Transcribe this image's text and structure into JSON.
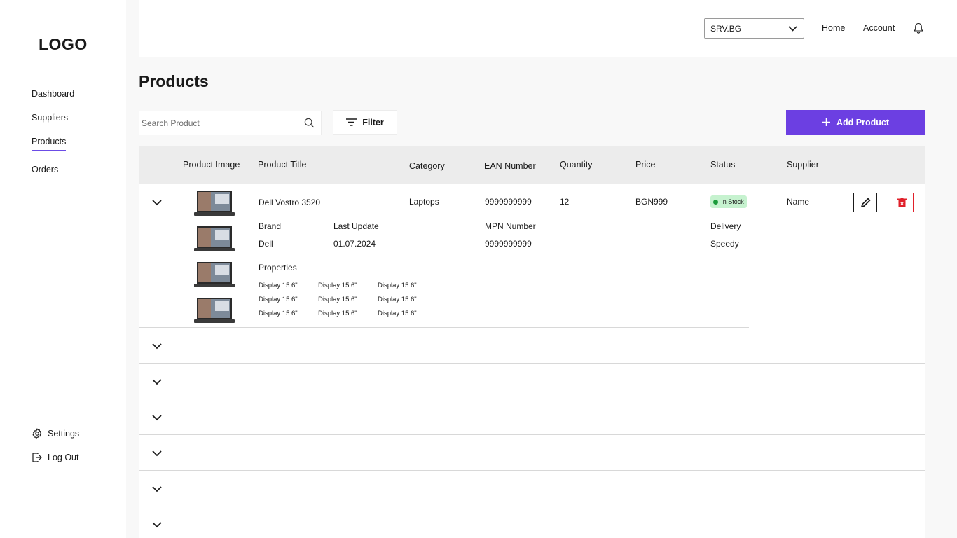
{
  "sidebar": {
    "logo": "LOGO",
    "items": [
      {
        "label": "Dashboard"
      },
      {
        "label": "Suppliers"
      },
      {
        "label": "Products"
      },
      {
        "label": "Orders"
      }
    ],
    "settings_label": "Settings",
    "logout_label": "Log Out",
    "active_item": "Products"
  },
  "header": {
    "store_select": "SRV.BG",
    "home_label": "Home",
    "account_label": "Account"
  },
  "main": {
    "title": "Products",
    "search_placeholder": "Search Product",
    "filter_label": "Filter",
    "add_label": "Add Product",
    "accent_color": "#6c3fe2"
  },
  "table": {
    "columns": [
      "Product Image",
      "Product Title",
      "Category",
      "EAN Number",
      "Quantity",
      "Price",
      "Status",
      "Supplier"
    ],
    "expanded_row": {
      "title": "Dell Vostro 3520",
      "category": "Laptops",
      "ean": "9999999999",
      "quantity": "12",
      "price": "BGN999",
      "status": "In Stock",
      "supplier": "Name",
      "brand_label": "Brand",
      "brand": "Dell",
      "last_update_label": "Last Update",
      "last_update": "01.07.2024",
      "mpn_label": "MPN Number",
      "mpn": "9999999999",
      "delivery_label": "Delivery",
      "delivery": "Speedy",
      "properties_label": "Properties",
      "properties": [
        [
          "Display 15.6\"",
          "Display 15.6\"",
          "Display 15.6\""
        ],
        [
          "Display 15.6\"",
          "Display 15.6\"",
          "Display 15.6\""
        ],
        [
          "Display 15.6\"",
          "Display 15.6\"",
          "Display 15.6\""
        ]
      ]
    },
    "collapsed_row_count": 6
  },
  "icons": [
    "chevron-down-icon",
    "search-icon",
    "filter-icon",
    "plus-icon",
    "bell-icon",
    "gear-icon",
    "logout-icon",
    "pencil-icon",
    "trash-icon"
  ]
}
